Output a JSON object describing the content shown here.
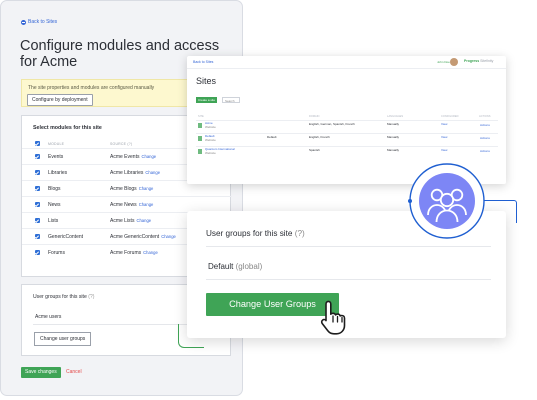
{
  "main": {
    "back_link": "Back to Sites",
    "title": "Configure modules and access for Acme",
    "notice": {
      "text": "The site properties and modules are configured manually",
      "button": "Configure by deployment"
    },
    "modules": {
      "title": "Select modules for this site",
      "headers": [
        "MODULE",
        "SOURCE (?)"
      ],
      "rows": [
        {
          "name": "Events",
          "source": "Acme Events",
          "change": "Change"
        },
        {
          "name": "Libraries",
          "source": "Acme Libraries",
          "change": "Change"
        },
        {
          "name": "Blogs",
          "source": "Acme Blogs",
          "change": "Change"
        },
        {
          "name": "News",
          "source": "Acme News",
          "change": "Change"
        },
        {
          "name": "Lists",
          "source": "Acme Lists",
          "change": "Change"
        },
        {
          "name": "GenericContent",
          "source": "Acme GenericContent",
          "change": "Change"
        },
        {
          "name": "Forums",
          "source": "Acme Forums",
          "change": "Change"
        }
      ]
    },
    "groups": {
      "title": "User groups for this site",
      "help": "(?)",
      "value": "Acme users",
      "button": "Change user groups"
    },
    "save_label": "Save changes",
    "cancel_label": "Cancel"
  },
  "sites": {
    "back": "Back to Sites",
    "user": "John Doe",
    "logo_main": "Progress",
    "logo_sub": " Sitefinity",
    "title": "Sites",
    "create_label": "Create a site",
    "search_label": "Search",
    "headers": [
      "SITE",
      "DOMAIN",
      "LANGUAGES",
      "CONFIGURED",
      "ACTIONS"
    ],
    "rows": [
      {
        "name": "Acme",
        "sub": "Website",
        "domain": "",
        "languages": "English, German, Spanish, French",
        "configured": "Manually",
        "view": "View",
        "actions": "Actions"
      },
      {
        "name": "Default",
        "sub": "Website",
        "domain": "Default",
        "languages": "English, French",
        "configured": "Manually",
        "view": "View",
        "actions": "Actions"
      },
      {
        "name": "Quantum International",
        "sub": "Website",
        "domain": "",
        "languages": "Spanish",
        "configured": "Manually",
        "view": "View",
        "actions": "Actions"
      }
    ]
  },
  "ug_panel": {
    "title": "User groups for this site",
    "help": "(?)",
    "default_label": "Default",
    "default_suffix": "(global)",
    "button": "Change User Groups"
  },
  "colors": {
    "accent_green": "#3fa456",
    "link_blue": "#3566d6",
    "circle_blue": "#1f5fd1",
    "cancel_red": "#e44848"
  },
  "icons": [
    "back-circle-icon",
    "checkbox-checked-icon",
    "pointing-hand-icon",
    "user-group-icon"
  ]
}
